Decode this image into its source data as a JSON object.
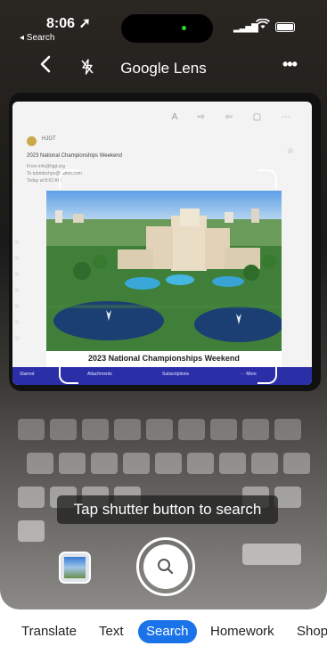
{
  "status_bar": {
    "time": "8:06",
    "location_icon": "➚",
    "back_app": "◂ Search"
  },
  "toolbar": {
    "back_icon": "back-chevron-icon",
    "flash_icon": "flash-off-icon",
    "title": "Google Lens",
    "more_icon": "more-icon"
  },
  "email": {
    "sender": "HJGT",
    "subject": "2023 National Championships Weekend",
    "from_line": "From info@hjgt.org",
    "to_line": "To tubridschpc@yahoo.com",
    "date_line": "Today at 8:02 AM",
    "photo_caption": "2023 National Championships Weekend",
    "tabs": [
      "Starred",
      "Attachments",
      "Subscriptions",
      "··· More"
    ]
  },
  "hint": "Tap shutter button to search",
  "modes": [
    {
      "label": "Translate",
      "active": false
    },
    {
      "label": "Text",
      "active": false
    },
    {
      "label": "Search",
      "active": true
    },
    {
      "label": "Homework",
      "active": false
    },
    {
      "label": "Shop",
      "active": false
    }
  ],
  "colors": {
    "accent": "#1a73e8",
    "mail_tabbar": "#2a2fa8"
  }
}
